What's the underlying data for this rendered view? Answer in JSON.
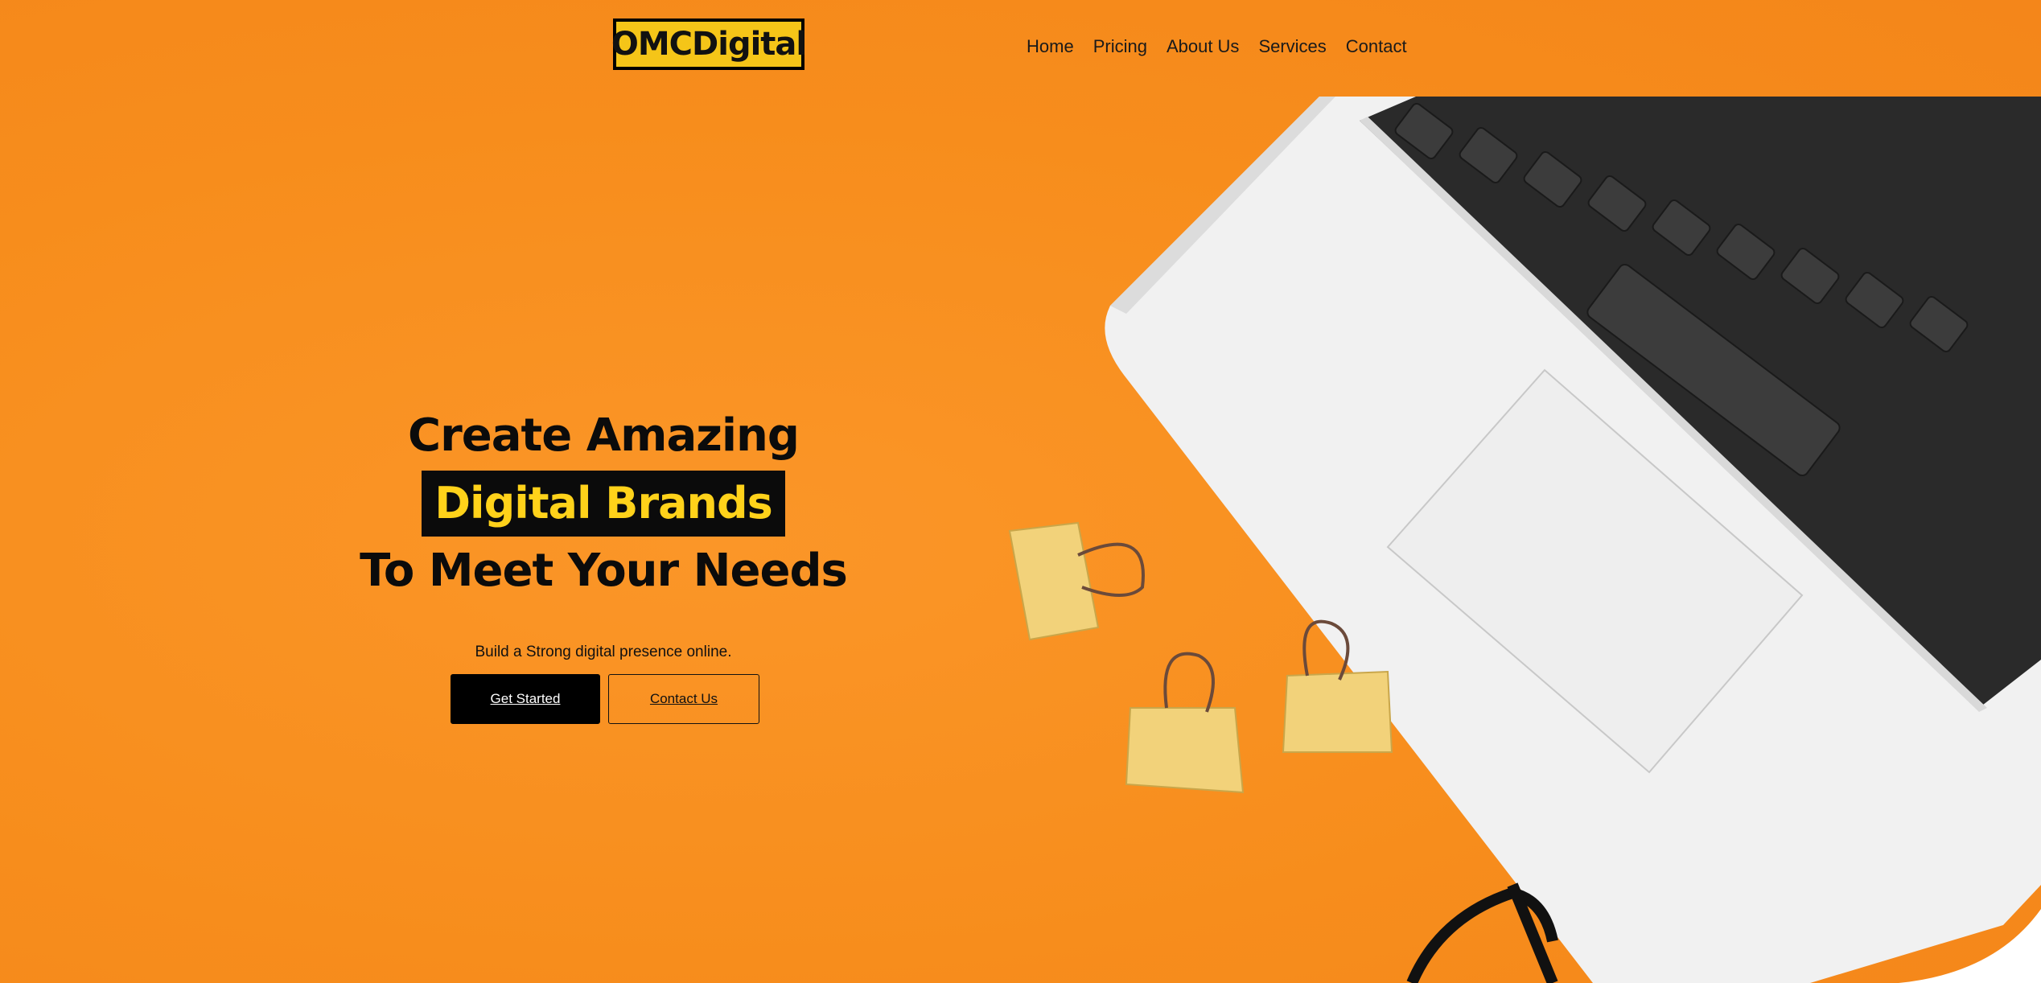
{
  "brand": {
    "logo_text": "OMCDigital"
  },
  "nav": {
    "items": [
      {
        "label": "Home"
      },
      {
        "label": "Pricing"
      },
      {
        "label": "About Us"
      },
      {
        "label": "Services"
      },
      {
        "label": "Contact"
      }
    ]
  },
  "hero": {
    "headline_line1": "Create Amazing",
    "headline_highlight": "Digital Brands",
    "headline_line3": "To Meet Your Needs",
    "tagline": "Build a Strong digital presence online.",
    "primary_cta": "Get Started",
    "secondary_cta": "Contact Us",
    "image_subject": "laptop-with-binder-clips-and-glasses"
  },
  "colors": {
    "background": "#f78f1e",
    "logo_bg": "#f5c518",
    "highlight_text": "#ffd21a",
    "dark": "#0b0b0b"
  }
}
